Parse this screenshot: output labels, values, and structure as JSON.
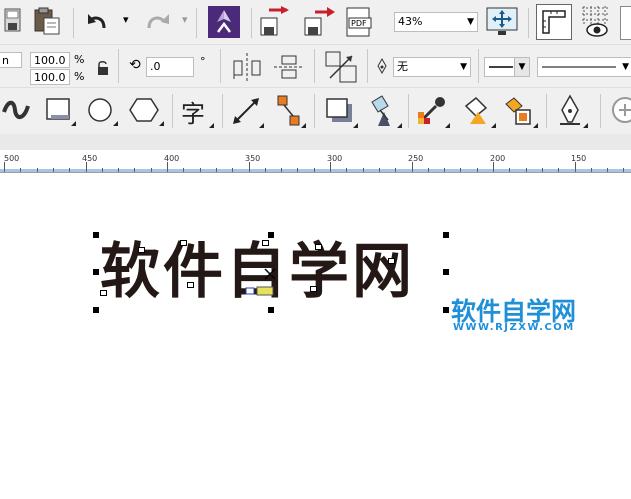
{
  "toolbar_standard": {
    "zoom_value": "43%",
    "pdf_label": "PDF",
    "icons": [
      "save-icon",
      "paste-icon",
      "undo-icon",
      "redo-icon",
      "app-launcher-icon",
      "import-icon",
      "export-icon",
      "publish-pdf-icon",
      "full-screen-icon",
      "rulers-icon",
      "view-options-icon"
    ]
  },
  "property_bar": {
    "scale_x": "100.0",
    "scale_y": "100.0",
    "percent_x": "%",
    "percent_y": "%",
    "rotation": ".0",
    "degree": "°",
    "outline_width": "无"
  },
  "toolbox": {
    "text_tool_label": "字",
    "icons": [
      "curve-icon",
      "rectangle-icon",
      "ellipse-icon",
      "polygon-icon",
      "text-icon",
      "dimension-icon",
      "connector-icon",
      "drop-shadow-icon",
      "transparency-icon",
      "eyedropper-icon",
      "fill-icon",
      "smart-fill-icon",
      "pen-icon",
      "zoom-in-icon"
    ]
  },
  "ruler": {
    "labels": [
      "500",
      "450",
      "400",
      "350",
      "300",
      "250",
      "200",
      "150"
    ]
  },
  "canvas": {
    "main_text": "软件自学网",
    "watermark_title": "软件自学网",
    "watermark_url": "WWW.RJZXW.COM"
  },
  "colors": {
    "text": "#231815",
    "watermark": "#1f8fd8",
    "toolbar_bg": "#f0f0f0"
  }
}
